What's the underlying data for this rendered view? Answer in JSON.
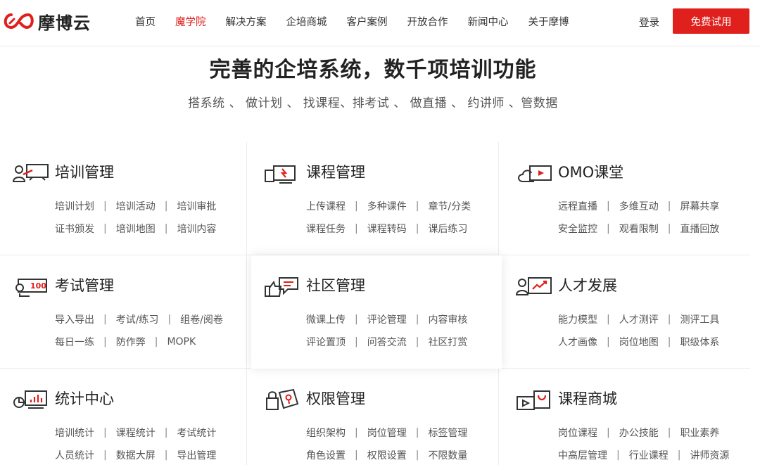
{
  "header": {
    "logo_text": "摩博云",
    "nav": [
      "首页",
      "魔学院",
      "解决方案",
      "企培商城",
      "客户案例",
      "开放合作",
      "新闻中心",
      "关于摩博"
    ],
    "active_nav": "魔学院",
    "login": "登录",
    "trial": "免费试用"
  },
  "hero": {
    "title": "完善的企培系统，数千项培训功能",
    "subtitle": "搭系统 、 做计划 、 找课程、排考试 、 做直播 、 约讲师 、管数据"
  },
  "colors": {
    "accent": "#e0201c",
    "text": "#333333",
    "muted": "#555555",
    "border": "#ececec"
  },
  "cards": [
    {
      "icon": "training-icon",
      "title": "培训管理",
      "row1": [
        "培训计划",
        "培训活动",
        "培训审批"
      ],
      "row2": [
        "证书颁发",
        "培训地图",
        "培训内容"
      ]
    },
    {
      "icon": "course-icon",
      "title": "课程管理",
      "row1": [
        "上传课程",
        "多种课件",
        "章节/分类"
      ],
      "row2": [
        "课程任务",
        "课程转码",
        "课后练习"
      ]
    },
    {
      "icon": "cloud-video-icon",
      "title": "OMO课堂",
      "row1": [
        "远程直播",
        "多维互动",
        "屏幕共享"
      ],
      "row2": [
        "安全监控",
        "观看限制",
        "直播回放"
      ]
    },
    {
      "icon": "exam-icon",
      "title": "考试管理",
      "row1": [
        "导入导出",
        "考试/练习",
        "组卷/阅卷"
      ],
      "row2": [
        "每日一练",
        "防作弊",
        "MOPK"
      ]
    },
    {
      "icon": "community-icon",
      "title": "社区管理",
      "row1": [
        "微课上传",
        "评论管理",
        "内容审核"
      ],
      "row2": [
        "评论置顶",
        "问答交流",
        "社区打赏"
      ]
    },
    {
      "icon": "talent-icon",
      "title": "人才发展",
      "row1": [
        "能力模型",
        "人才测评",
        "测评工具"
      ],
      "row2": [
        "人才画像",
        "岗位地图",
        "职级体系"
      ]
    },
    {
      "icon": "statistics-icon",
      "title": "统计中心",
      "row1": [
        "培训统计",
        "课程统计",
        "考试统计"
      ],
      "row2": [
        "人员统计",
        "数据大屏",
        "导出管理"
      ]
    },
    {
      "icon": "permission-icon",
      "title": "权限管理",
      "row1": [
        "组织架构",
        "岗位管理",
        "标签管理"
      ],
      "row2": [
        "角色设置",
        "权限设置",
        "不限数量"
      ]
    },
    {
      "icon": "course-mall-icon",
      "title": "课程商城",
      "row1": [
        "岗位课程",
        "办公技能",
        "职业素养"
      ],
      "row2": [
        "中高层管理",
        "行业课程",
        "讲师资源"
      ]
    }
  ]
}
